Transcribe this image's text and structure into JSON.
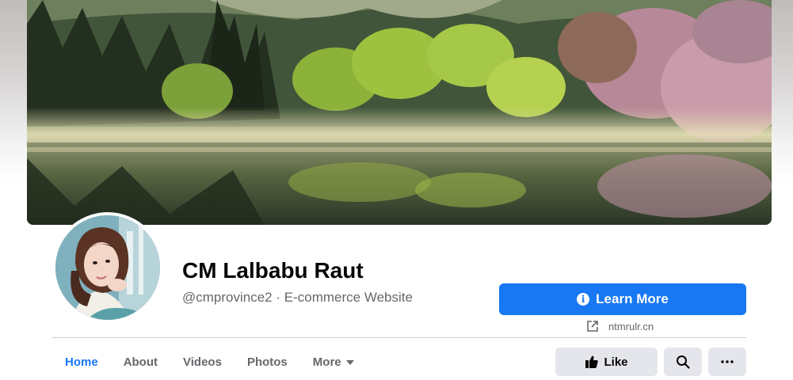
{
  "cover": {
    "description_icon": "landscape-photo"
  },
  "profile": {
    "name": "CM Lalbabu Raut",
    "handle": "@cmprovince2",
    "separator": "·",
    "category": "E-commerce Website"
  },
  "cta": {
    "label": "Learn More",
    "icon": "info-icon",
    "link_text": "ntmrulr.cn",
    "link_icon": "external-link-icon",
    "color": "#1877f2"
  },
  "tabs": [
    {
      "label": "Home",
      "active": true
    },
    {
      "label": "About",
      "active": false
    },
    {
      "label": "Videos",
      "active": false
    },
    {
      "label": "Photos",
      "active": false
    },
    {
      "label": "More",
      "active": false,
      "has_dropdown": true
    }
  ],
  "actions": {
    "like_label": "Like",
    "like_icon": "thumbs-up-icon",
    "search_icon": "search-icon",
    "more_icon": "more-dots-icon"
  }
}
